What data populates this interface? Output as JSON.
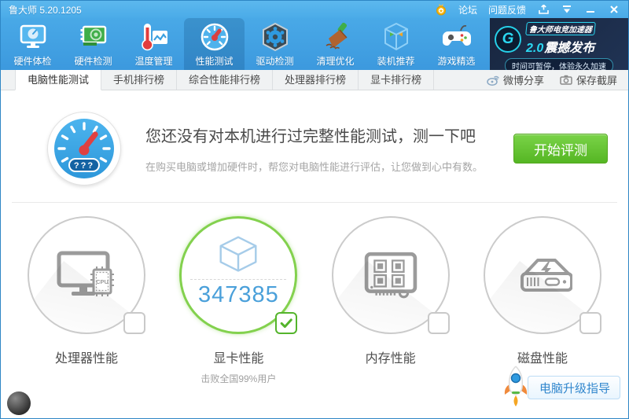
{
  "titlebar": {
    "app_title": "鲁大师 5.20.1205",
    "forum_label": "论坛",
    "feedback_label": "问题反馈"
  },
  "nav": {
    "active_index": 3,
    "items": [
      {
        "label": "硬件体检",
        "icon": "hardware-checkup-icon"
      },
      {
        "label": "硬件检测",
        "icon": "hardware-detect-icon"
      },
      {
        "label": "温度管理",
        "icon": "temperature-icon"
      },
      {
        "label": "性能测试",
        "icon": "performance-gauge-icon"
      },
      {
        "label": "驱动检测",
        "icon": "driver-detect-icon"
      },
      {
        "label": "清理优化",
        "icon": "clean-optimize-icon"
      },
      {
        "label": "装机推荐",
        "icon": "build-recommend-icon"
      },
      {
        "label": "游戏精选",
        "icon": "game-picks-icon"
      }
    ]
  },
  "promo": {
    "name": "鲁大师电竞加速器",
    "version": "2.0",
    "release": "震撼发布",
    "tagline": "时间可暂停，体验永久加速"
  },
  "tabs": {
    "active_index": 0,
    "items": [
      {
        "label": "电脑性能测试"
      },
      {
        "label": "手机排行榜"
      },
      {
        "label": "综合性能排行榜"
      },
      {
        "label": "处理器排行榜"
      },
      {
        "label": "显卡排行榜"
      }
    ],
    "actions": [
      {
        "label": "微博分享",
        "icon": "weibo-icon"
      },
      {
        "label": "保存截屏",
        "icon": "camera-icon"
      }
    ]
  },
  "intro": {
    "gauge_value": "???",
    "heading": "您还没有对本机进行过完整性能测试，测一下吧",
    "subtext": "在购买电脑或增加硬件时，帮您对电脑性能进行评估，让您做到心中有数。",
    "start_button": "开始评测"
  },
  "benchmarks": [
    {
      "label": "处理器性能",
      "icon": "cpu-monitor-icon",
      "chip_label": "CPU",
      "checked": false
    },
    {
      "label": "显卡性能",
      "icon": "gpu-cube-icon",
      "checked": true,
      "score": "347385",
      "beat_text": "击败全国99%用户"
    },
    {
      "label": "内存性能",
      "icon": "memory-icon",
      "checked": false
    },
    {
      "label": "磁盘性能",
      "icon": "disk-icon",
      "checked": false
    }
  ],
  "footer": {
    "upgrade_guide": "电脑升级指导"
  },
  "colors": {
    "header_blue": "#45a5e5",
    "promo_navy": "#1b2b47",
    "promo_cyan": "#2bd8f2",
    "accent_green": "#55b624",
    "score_blue": "#4aa0da",
    "circle_green": "#83d14e"
  }
}
